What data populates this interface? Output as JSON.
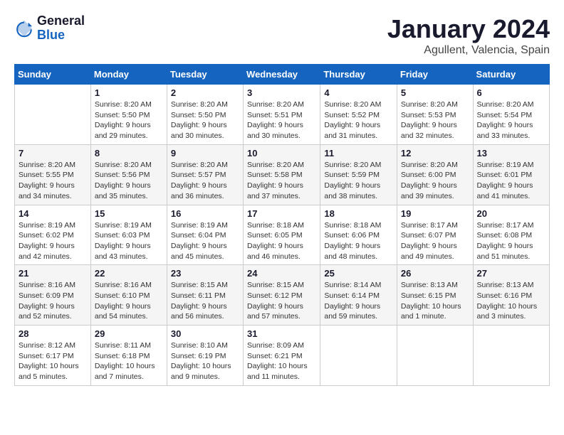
{
  "logo": {
    "general": "General",
    "blue": "Blue"
  },
  "header": {
    "month": "January 2024",
    "location": "Agullent, Valencia, Spain"
  },
  "weekdays": [
    "Sunday",
    "Monday",
    "Tuesday",
    "Wednesday",
    "Thursday",
    "Friday",
    "Saturday"
  ],
  "weeks": [
    [
      {
        "day": null
      },
      {
        "day": "1",
        "sunrise": "8:20 AM",
        "sunset": "5:50 PM",
        "daylight": "9 hours and 29 minutes."
      },
      {
        "day": "2",
        "sunrise": "8:20 AM",
        "sunset": "5:50 PM",
        "daylight": "9 hours and 30 minutes."
      },
      {
        "day": "3",
        "sunrise": "8:20 AM",
        "sunset": "5:51 PM",
        "daylight": "9 hours and 30 minutes."
      },
      {
        "day": "4",
        "sunrise": "8:20 AM",
        "sunset": "5:52 PM",
        "daylight": "9 hours and 31 minutes."
      },
      {
        "day": "5",
        "sunrise": "8:20 AM",
        "sunset": "5:53 PM",
        "daylight": "9 hours and 32 minutes."
      },
      {
        "day": "6",
        "sunrise": "8:20 AM",
        "sunset": "5:54 PM",
        "daylight": "9 hours and 33 minutes."
      }
    ],
    [
      {
        "day": "7",
        "sunrise": "8:20 AM",
        "sunset": "5:55 PM",
        "daylight": "9 hours and 34 minutes."
      },
      {
        "day": "8",
        "sunrise": "8:20 AM",
        "sunset": "5:56 PM",
        "daylight": "9 hours and 35 minutes."
      },
      {
        "day": "9",
        "sunrise": "8:20 AM",
        "sunset": "5:57 PM",
        "daylight": "9 hours and 36 minutes."
      },
      {
        "day": "10",
        "sunrise": "8:20 AM",
        "sunset": "5:58 PM",
        "daylight": "9 hours and 37 minutes."
      },
      {
        "day": "11",
        "sunrise": "8:20 AM",
        "sunset": "5:59 PM",
        "daylight": "9 hours and 38 minutes."
      },
      {
        "day": "12",
        "sunrise": "8:20 AM",
        "sunset": "6:00 PM",
        "daylight": "9 hours and 39 minutes."
      },
      {
        "day": "13",
        "sunrise": "8:19 AM",
        "sunset": "6:01 PM",
        "daylight": "9 hours and 41 minutes."
      }
    ],
    [
      {
        "day": "14",
        "sunrise": "8:19 AM",
        "sunset": "6:02 PM",
        "daylight": "9 hours and 42 minutes."
      },
      {
        "day": "15",
        "sunrise": "8:19 AM",
        "sunset": "6:03 PM",
        "daylight": "9 hours and 43 minutes."
      },
      {
        "day": "16",
        "sunrise": "8:19 AM",
        "sunset": "6:04 PM",
        "daylight": "9 hours and 45 minutes."
      },
      {
        "day": "17",
        "sunrise": "8:18 AM",
        "sunset": "6:05 PM",
        "daylight": "9 hours and 46 minutes."
      },
      {
        "day": "18",
        "sunrise": "8:18 AM",
        "sunset": "6:06 PM",
        "daylight": "9 hours and 48 minutes."
      },
      {
        "day": "19",
        "sunrise": "8:17 AM",
        "sunset": "6:07 PM",
        "daylight": "9 hours and 49 minutes."
      },
      {
        "day": "20",
        "sunrise": "8:17 AM",
        "sunset": "6:08 PM",
        "daylight": "9 hours and 51 minutes."
      }
    ],
    [
      {
        "day": "21",
        "sunrise": "8:16 AM",
        "sunset": "6:09 PM",
        "daylight": "9 hours and 52 minutes."
      },
      {
        "day": "22",
        "sunrise": "8:16 AM",
        "sunset": "6:10 PM",
        "daylight": "9 hours and 54 minutes."
      },
      {
        "day": "23",
        "sunrise": "8:15 AM",
        "sunset": "6:11 PM",
        "daylight": "9 hours and 56 minutes."
      },
      {
        "day": "24",
        "sunrise": "8:15 AM",
        "sunset": "6:12 PM",
        "daylight": "9 hours and 57 minutes."
      },
      {
        "day": "25",
        "sunrise": "8:14 AM",
        "sunset": "6:14 PM",
        "daylight": "9 hours and 59 minutes."
      },
      {
        "day": "26",
        "sunrise": "8:13 AM",
        "sunset": "6:15 PM",
        "daylight": "10 hours and 1 minute."
      },
      {
        "day": "27",
        "sunrise": "8:13 AM",
        "sunset": "6:16 PM",
        "daylight": "10 hours and 3 minutes."
      }
    ],
    [
      {
        "day": "28",
        "sunrise": "8:12 AM",
        "sunset": "6:17 PM",
        "daylight": "10 hours and 5 minutes."
      },
      {
        "day": "29",
        "sunrise": "8:11 AM",
        "sunset": "6:18 PM",
        "daylight": "10 hours and 7 minutes."
      },
      {
        "day": "30",
        "sunrise": "8:10 AM",
        "sunset": "6:19 PM",
        "daylight": "10 hours and 9 minutes."
      },
      {
        "day": "31",
        "sunrise": "8:09 AM",
        "sunset": "6:21 PM",
        "daylight": "10 hours and 11 minutes."
      },
      {
        "day": null
      },
      {
        "day": null
      },
      {
        "day": null
      }
    ]
  ]
}
